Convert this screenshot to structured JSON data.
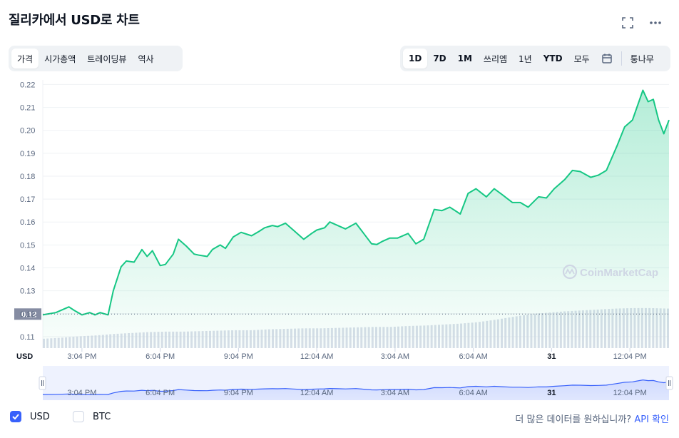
{
  "header": {
    "title": "질리카에서 USD로 차트",
    "icons": [
      "fullscreen-icon",
      "more-icon"
    ]
  },
  "tabs": {
    "view": [
      {
        "label": "가격",
        "active": true
      },
      {
        "label": "시가총액",
        "active": false
      },
      {
        "label": "트레이딩뷰",
        "active": false
      },
      {
        "label": "역사",
        "active": false
      }
    ],
    "range": [
      {
        "label": "1D",
        "active": true
      },
      {
        "label": "7D",
        "active": false
      },
      {
        "label": "1M",
        "active": false
      },
      {
        "label": "쓰리엠",
        "active": false
      },
      {
        "label": "1년",
        "active": false
      },
      {
        "label": "YTD",
        "active": false
      },
      {
        "label": "모두",
        "active": false
      }
    ],
    "extra_label": "퉁나무"
  },
  "chart_data": {
    "type": "area",
    "currency_label": "USD",
    "ylim": [
      0.105,
      0.222
    ],
    "y_ticks": [
      "0.22",
      "0.21",
      "0.20",
      "0.19",
      "0.18",
      "0.17",
      "0.16",
      "0.15",
      "0.14",
      "0.13",
      "0.12",
      "0.11"
    ],
    "current_value": "0.12",
    "x_ticks": [
      "3:04 PM",
      "6:04 PM",
      "9:04 PM",
      "12:04 AM",
      "3:04 AM",
      "6:04 AM",
      "31",
      "12:04 PM"
    ],
    "x_tick_bold": [
      false,
      false,
      false,
      false,
      false,
      false,
      true,
      false
    ],
    "grid": true,
    "watermark": "CoinMarketCap",
    "colors": {
      "line": "#16c784",
      "fill_top": "#16c784",
      "volume": "#cfd6e4",
      "navigator_line": "#3861fb"
    },
    "x": [
      0,
      0.5,
      1,
      1.2,
      1.5,
      1.8,
      2,
      2.2,
      2.5,
      2.7,
      3,
      3.2,
      3.5,
      3.8,
      4,
      4.2,
      4.5,
      4.7,
      5,
      5.2,
      5.5,
      5.8,
      6,
      6.3,
      6.5,
      6.8,
      7,
      7.3,
      7.6,
      8,
      8.3,
      8.5,
      8.8,
      9,
      9.3,
      9.6,
      10,
      10.3,
      10.5,
      10.8,
      11,
      11.3,
      11.6,
      12,
      12.3,
      12.6,
      12.8,
      13,
      13.3,
      13.6,
      14,
      14.3,
      14.6,
      15,
      15.3,
      15.6,
      16,
      16.3,
      16.6,
      17,
      17.3,
      17.6,
      18,
      18.3,
      18.6,
      19,
      19.3,
      19.6,
      20,
      20.3,
      20.6,
      21,
      21.3,
      21.6,
      22,
      22.3,
      22.6,
      23,
      23.2,
      23.4,
      23.6,
      23.8,
      24
    ],
    "y": [
      0.1195,
      0.1205,
      0.123,
      0.1215,
      0.1195,
      0.1205,
      0.1195,
      0.1205,
      0.1195,
      0.13,
      0.1405,
      0.143,
      0.1425,
      0.148,
      0.145,
      0.1475,
      0.141,
      0.1415,
      0.146,
      0.1525,
      0.1495,
      0.146,
      0.1455,
      0.145,
      0.148,
      0.15,
      0.1485,
      0.1535,
      0.1555,
      0.154,
      0.156,
      0.1575,
      0.1585,
      0.158,
      0.1595,
      0.1565,
      0.1525,
      0.155,
      0.1565,
      0.1575,
      0.16,
      0.1585,
      0.157,
      0.1595,
      0.155,
      0.1505,
      0.1502,
      0.1515,
      0.153,
      0.153,
      0.155,
      0.1505,
      0.1525,
      0.1655,
      0.165,
      0.1665,
      0.1635,
      0.1725,
      0.1745,
      0.171,
      0.1745,
      0.172,
      0.1685,
      0.1685,
      0.1665,
      0.171,
      0.1705,
      0.1745,
      0.1785,
      0.1825,
      0.182,
      0.1795,
      0.1805,
      0.1825,
      0.193,
      0.2015,
      0.2045,
      0.2175,
      0.2125,
      0.2135,
      0.2045,
      0.1985,
      0.2045
    ],
    "x_tick_positions": [
      1.5,
      4.5,
      7.5,
      10.5,
      13.5,
      16.5,
      19.5,
      22.5
    ],
    "volume": [
      0.2,
      0.22,
      0.25,
      0.27,
      0.3,
      0.32,
      0.34,
      0.35,
      0.35,
      0.36,
      0.37,
      0.38,
      0.38,
      0.4,
      0.41,
      0.42,
      0.42,
      0.43,
      0.44,
      0.45,
      0.45,
      0.47,
      0.48,
      0.5,
      0.52,
      0.55,
      0.6,
      0.66,
      0.72,
      0.75,
      0.78,
      0.8,
      0.82,
      0.84,
      0.85,
      0.85,
      0.84
    ]
  },
  "navigator": {
    "x_ticks": [
      "3:04 PM",
      "6:04 PM",
      "9:04 PM",
      "12:04 AM",
      "3:04 AM",
      "6:04 AM",
      "31",
      "12:04 PM"
    ]
  },
  "legend": [
    {
      "label": "USD",
      "checked": true
    },
    {
      "label": "BTC",
      "checked": false
    }
  ],
  "footer": {
    "text": "더 많은 데이터를 원하십니까?",
    "link_api": "API",
    "link_confirm": "확인"
  }
}
